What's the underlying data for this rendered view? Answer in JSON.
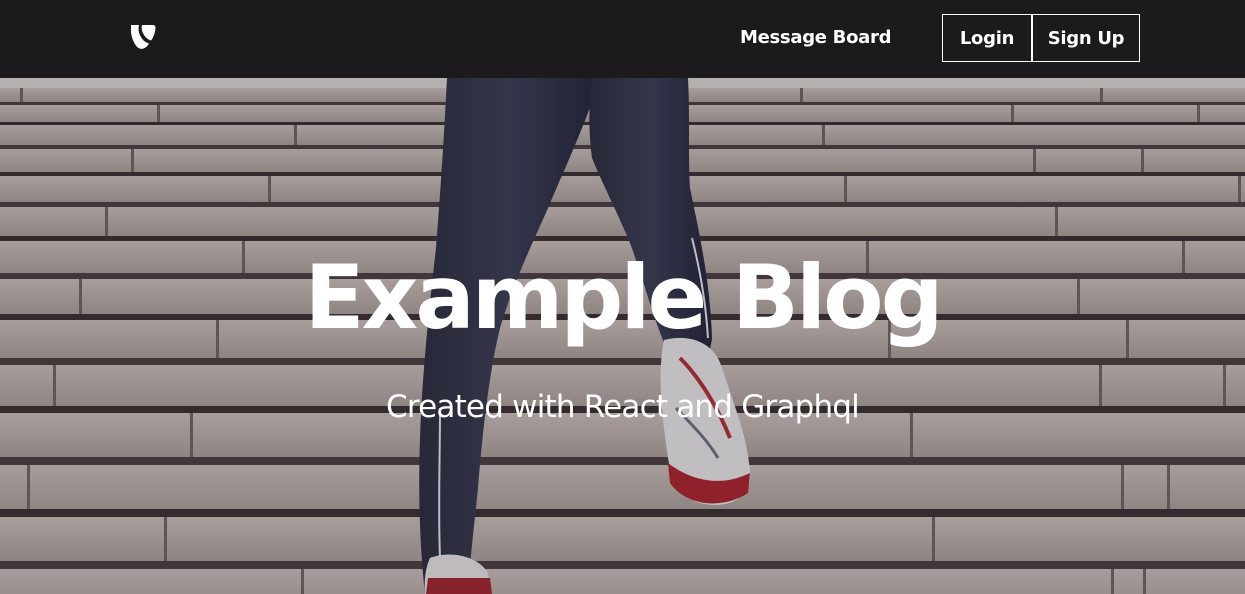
{
  "navbar": {
    "logo_icon": "typo3-logo-icon",
    "links": [
      {
        "label": "Message Board"
      }
    ],
    "login_label": "Login",
    "signup_label": "Sign Up",
    "background_color": "#1c1a1c",
    "text_color": "#ffffff"
  },
  "hero": {
    "title": "Example Blog",
    "subtitle": "Created with React and Graphql",
    "background_image": "runner-climbing-stone-stairs"
  }
}
